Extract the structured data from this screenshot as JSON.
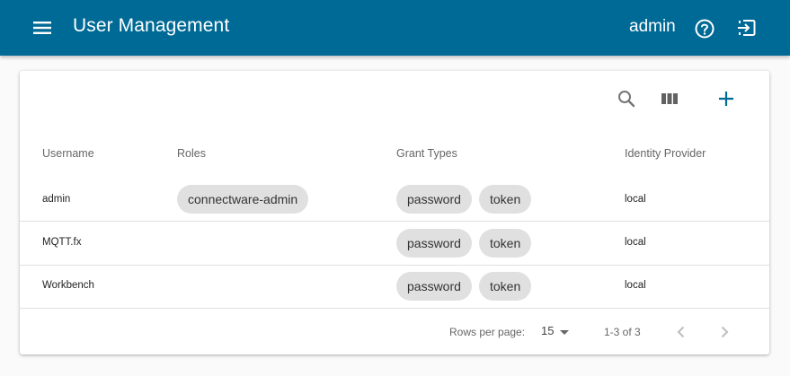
{
  "appbar": {
    "title": "User Management",
    "username": "admin",
    "icons": {
      "menu": "menu-icon",
      "help": "help-circle-icon",
      "logout": "logout-icon"
    },
    "color": "#006a96"
  },
  "toolbar": {
    "icons": [
      "search-icon",
      "view-columns-icon",
      "add-icon"
    ],
    "accent": "#006a96"
  },
  "table": {
    "columns": [
      "Username",
      "Roles",
      "Grant Types",
      "Identity Provider"
    ],
    "rows": [
      {
        "username": "admin",
        "roles": [
          "connectware-admin"
        ],
        "grant_types": [
          "password",
          "token"
        ],
        "identity_provider": "local"
      },
      {
        "username": "MQTT.fx",
        "roles": [],
        "grant_types": [
          "password",
          "token"
        ],
        "identity_provider": "local"
      },
      {
        "username": "Workbench",
        "roles": [],
        "grant_types": [
          "password",
          "token"
        ],
        "identity_provider": "local"
      }
    ]
  },
  "pagination": {
    "rows_per_page_label": "Rows per page:",
    "rows_per_page_value": "15",
    "range_label": "1-3 of 3",
    "icons": {
      "prev": "chevron-left-icon",
      "next": "chevron-right-icon"
    }
  }
}
